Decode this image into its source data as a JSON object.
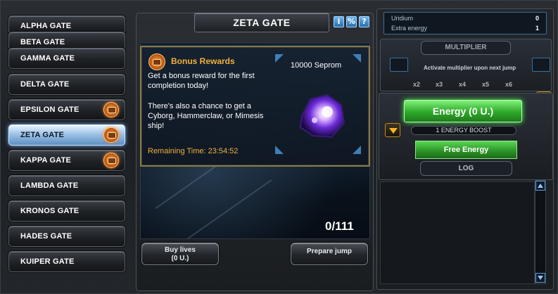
{
  "gates": [
    {
      "label": "ALPHA GATE",
      "badge": false,
      "active": false
    },
    {
      "label": "BETA GATE",
      "badge": false,
      "active": false
    },
    {
      "label": "GAMMA GATE",
      "badge": false,
      "active": false
    },
    {
      "label": "DELTA GATE",
      "badge": false,
      "active": false
    },
    {
      "label": "EPSILON GATE",
      "badge": true,
      "active": false
    },
    {
      "label": "ZETA GATE",
      "badge": true,
      "active": true
    },
    {
      "label": "KAPPA GATE",
      "badge": true,
      "active": false
    },
    {
      "label": "LAMBDA GATE",
      "badge": false,
      "active": false
    },
    {
      "label": "KRONOS GATE",
      "badge": false,
      "active": false
    },
    {
      "label": "HADES GATE",
      "badge": false,
      "active": false
    },
    {
      "label": "KUIPER GATE",
      "badge": false,
      "active": false
    }
  ],
  "header": {
    "title": "ZETA GATE",
    "tools": [
      "i",
      "%",
      "?"
    ]
  },
  "reward": {
    "title": "Bonus Rewards",
    "amount": "10000 Seprom",
    "text1": "Get a bonus reward for the first completion today!",
    "text2": "There's also a chance to get a Cyborg, Hammerclaw, or Mimesis ship!",
    "remaining": "Remaining Time: 23:54:52"
  },
  "progress": {
    "text": "0/111"
  },
  "actions": {
    "buy_lives_line1": "Buy lives",
    "buy_lives_line2": "(0 U.)",
    "prepare_jump": "Prepare jump"
  },
  "stats": {
    "uridium_label": "Uridium",
    "uridium_value": "0",
    "extra_energy_label": "Extra energy",
    "extra_energy_value": "1"
  },
  "multiplier": {
    "title": "MULTIPLIER",
    "note": "Activate multiplier upon next jump",
    "options": [
      "x2",
      "x3",
      "x4",
      "x5",
      "x6"
    ]
  },
  "energy": {
    "button": "Energy (0 U.)",
    "boost": "1 ENERGY BOOST",
    "free": "Free Energy",
    "log": "LOG"
  },
  "colors": {
    "accent_gold": "#f1b13a",
    "energy_green": "#2ea82a",
    "active_blue": "#9ec3e6"
  }
}
